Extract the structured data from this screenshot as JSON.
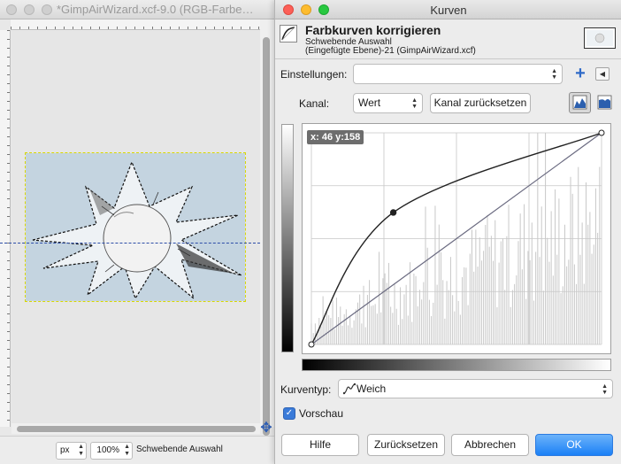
{
  "image_window": {
    "title": "*GimpAirWizard.xcf-9.0 (RGB-Farbe…",
    "status": {
      "unit": "px",
      "zoom": "100%",
      "selection_text": "Schwebende Auswahl"
    }
  },
  "dialog": {
    "window_title": "Kurven",
    "header": {
      "title": "Farbkurven korrigieren",
      "subtitle1": "Schwebende Auswahl",
      "subtitle2": "(Eingefügte Ebene)-21 (GimpAirWizard.xcf)"
    },
    "settings": {
      "label": "Einstellungen:",
      "value": ""
    },
    "channel": {
      "label": "Kanal:",
      "value": "Wert",
      "reset_label": "Kanal zurücksetzen"
    },
    "curve": {
      "coordinate_readout": "x: 46 y:158",
      "control_points": [
        [
          0,
          0
        ],
        [
          72,
          159
        ],
        [
          255,
          255
        ]
      ],
      "histogram_color": "#c8c8c8",
      "curve_color": "#222222",
      "diagonal_color": "#6a6a80"
    },
    "curve_type": {
      "label": "Kurventyp:",
      "value": "Weich"
    },
    "preview": {
      "label": "Vorschau",
      "checked": true
    },
    "buttons": {
      "help": "Hilfe",
      "reset": "Zurücksetzen",
      "cancel": "Abbrechen",
      "ok": "OK"
    },
    "accent_color": "#1b80f6"
  }
}
